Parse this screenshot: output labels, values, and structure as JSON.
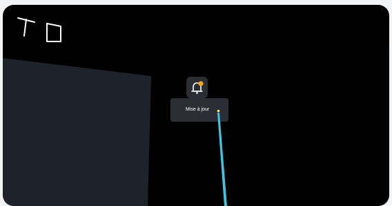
{
  "header": {
    "corner_label": "T O"
  },
  "notification": {
    "icon": "bell-icon",
    "badge_color": "#f5a623",
    "button_bg": "#2a2d33"
  },
  "tooltip": {
    "label": "Mise à jour"
  },
  "pointer": {
    "ray_color": "#3ec6e0",
    "cursor_color": "#ffe94d"
  },
  "scene": {
    "panel_color": "#1e222a",
    "background": "#000000"
  }
}
